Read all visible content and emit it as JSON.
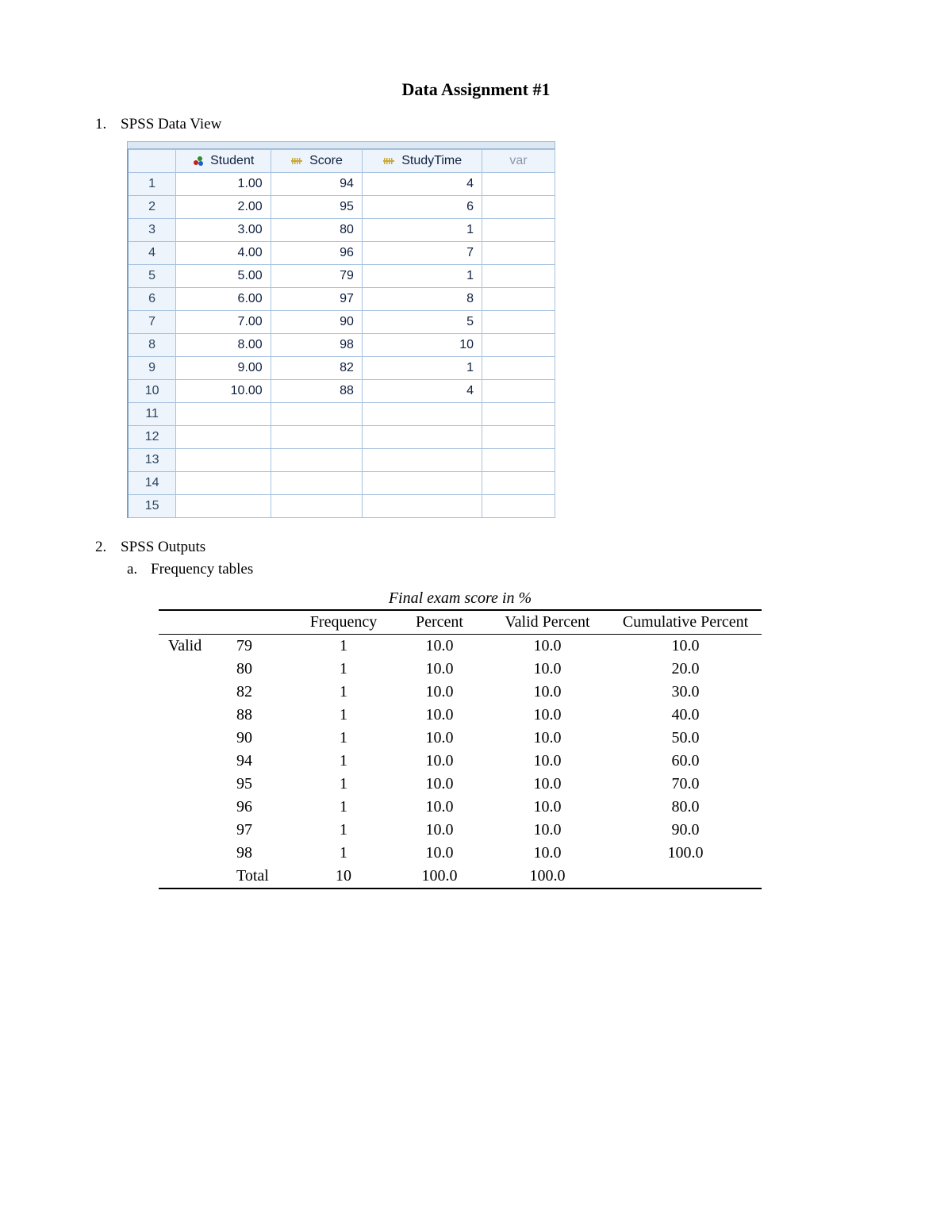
{
  "title": "Data Assignment #1",
  "item1": {
    "marker": "1.",
    "label": "SPSS Data View"
  },
  "item2": {
    "marker": "2.",
    "label": "SPSS Outputs"
  },
  "item2a": {
    "marker": "a.",
    "label": "Frequency tables"
  },
  "spss": {
    "headers": {
      "student": "Student",
      "score": "Score",
      "studytime": "StudyTime",
      "var": "var"
    },
    "rows": [
      {
        "n": "1",
        "student": "1.00",
        "score": "94",
        "study": "4"
      },
      {
        "n": "2",
        "student": "2.00",
        "score": "95",
        "study": "6"
      },
      {
        "n": "3",
        "student": "3.00",
        "score": "80",
        "study": "1"
      },
      {
        "n": "4",
        "student": "4.00",
        "score": "96",
        "study": "7"
      },
      {
        "n": "5",
        "student": "5.00",
        "score": "79",
        "study": "1"
      },
      {
        "n": "6",
        "student": "6.00",
        "score": "97",
        "study": "8"
      },
      {
        "n": "7",
        "student": "7.00",
        "score": "90",
        "study": "5"
      },
      {
        "n": "8",
        "student": "8.00",
        "score": "98",
        "study": "10"
      },
      {
        "n": "9",
        "student": "9.00",
        "score": "82",
        "study": "1"
      },
      {
        "n": "10",
        "student": "10.00",
        "score": "88",
        "study": "4"
      },
      {
        "n": "11",
        "student": "",
        "score": "",
        "study": ""
      },
      {
        "n": "12",
        "student": "",
        "score": "",
        "study": ""
      },
      {
        "n": "13",
        "student": "",
        "score": "",
        "study": ""
      },
      {
        "n": "14",
        "student": "",
        "score": "",
        "study": ""
      },
      {
        "n": "15",
        "student": "",
        "score": "",
        "study": ""
      }
    ]
  },
  "freq": {
    "caption": "Final exam score in %",
    "headers": {
      "blank": "",
      "value": "",
      "freq": "Frequency",
      "pct": "Percent",
      "vpct": "Valid Percent",
      "cum": "Cumulative Percent"
    },
    "valid_label": "Valid",
    "rows": [
      {
        "value": "79",
        "freq": "1",
        "pct": "10.0",
        "vpct": "10.0",
        "cum": "10.0"
      },
      {
        "value": "80",
        "freq": "1",
        "pct": "10.0",
        "vpct": "10.0",
        "cum": "20.0"
      },
      {
        "value": "82",
        "freq": "1",
        "pct": "10.0",
        "vpct": "10.0",
        "cum": "30.0"
      },
      {
        "value": "88",
        "freq": "1",
        "pct": "10.0",
        "vpct": "10.0",
        "cum": "40.0"
      },
      {
        "value": "90",
        "freq": "1",
        "pct": "10.0",
        "vpct": "10.0",
        "cum": "50.0"
      },
      {
        "value": "94",
        "freq": "1",
        "pct": "10.0",
        "vpct": "10.0",
        "cum": "60.0"
      },
      {
        "value": "95",
        "freq": "1",
        "pct": "10.0",
        "vpct": "10.0",
        "cum": "70.0"
      },
      {
        "value": "96",
        "freq": "1",
        "pct": "10.0",
        "vpct": "10.0",
        "cum": "80.0"
      },
      {
        "value": "97",
        "freq": "1",
        "pct": "10.0",
        "vpct": "10.0",
        "cum": "90.0"
      },
      {
        "value": "98",
        "freq": "1",
        "pct": "10.0",
        "vpct": "10.0",
        "cum": "100.0"
      }
    ],
    "total": {
      "label": "Total",
      "freq": "10",
      "pct": "100.0",
      "vpct": "100.0",
      "cum": ""
    }
  },
  "chart_data": {
    "type": "table",
    "title": "Final exam score in %",
    "columns": [
      "Score",
      "Frequency",
      "Percent",
      "Valid Percent",
      "Cumulative Percent"
    ],
    "rows": [
      [
        "79",
        1,
        10.0,
        10.0,
        10.0
      ],
      [
        "80",
        1,
        10.0,
        10.0,
        20.0
      ],
      [
        "82",
        1,
        10.0,
        10.0,
        30.0
      ],
      [
        "88",
        1,
        10.0,
        10.0,
        40.0
      ],
      [
        "90",
        1,
        10.0,
        10.0,
        50.0
      ],
      [
        "94",
        1,
        10.0,
        10.0,
        60.0
      ],
      [
        "95",
        1,
        10.0,
        10.0,
        70.0
      ],
      [
        "96",
        1,
        10.0,
        10.0,
        80.0
      ],
      [
        "97",
        1,
        10.0,
        10.0,
        90.0
      ],
      [
        "98",
        1,
        10.0,
        10.0,
        100.0
      ],
      [
        "Total",
        10,
        100.0,
        100.0,
        null
      ]
    ]
  }
}
